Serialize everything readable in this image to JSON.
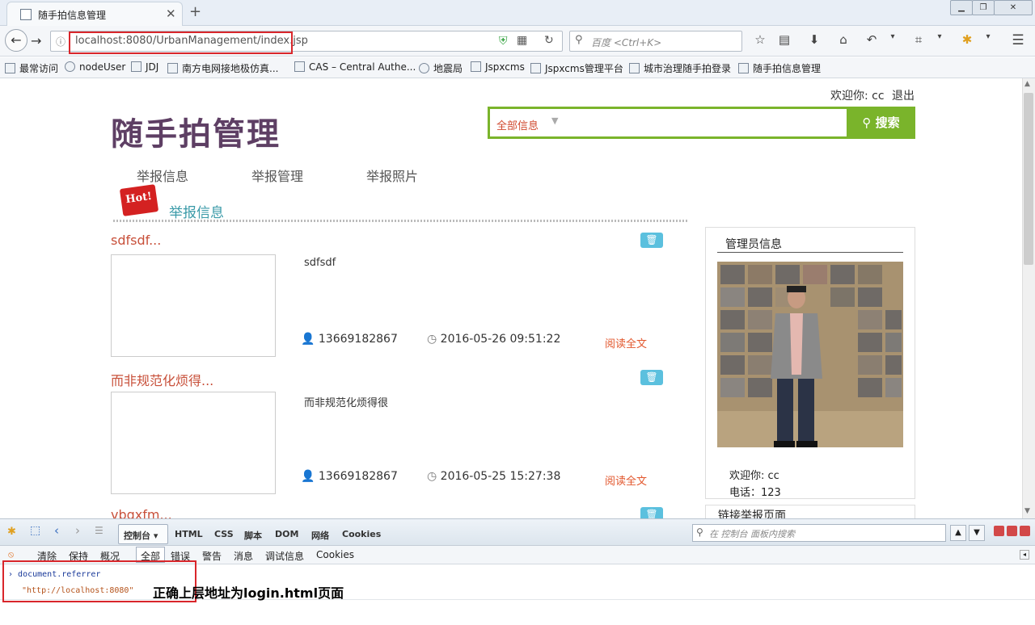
{
  "browser": {
    "tab_title": "随手拍信息管理",
    "url": "localhost:8080/UrbanManagement/index.jsp",
    "search_placeholder": "百度 <Ctrl+K>",
    "bookmarks": [
      "最常访问",
      "nodeUser",
      "JDJ",
      "南方电网接地极仿真...",
      "CAS – Central Authe...",
      "地震局",
      "Jspxcms",
      "Jspxcms管理平台",
      "城市治理随手拍登录",
      "随手拍信息管理"
    ]
  },
  "header": {
    "welcome": "欢迎你: cc",
    "logout": "退出",
    "logo_text": "随手拍管理",
    "search_category": "全部信息",
    "search_button": "搜索"
  },
  "menu": [
    "举报信息",
    "举报管理",
    "举报照片"
  ],
  "section": {
    "hot_badge": "Hot!",
    "title": "举报信息"
  },
  "items": [
    {
      "title": "sdfsdf...",
      "desc": "sdfsdf",
      "phone": "13669182867",
      "time": "2016-05-26 09:51:22",
      "read_more": "阅读全文"
    },
    {
      "title": "而非规范化烦得...",
      "desc": "而非规范化烦得很",
      "phone": "13669182867",
      "time": "2016-05-25 15:27:38",
      "read_more": "阅读全文"
    },
    {
      "title": "vbgxfm..."
    }
  ],
  "admin": {
    "title": "管理员信息",
    "welcome": "欢迎你: cc",
    "phone": "电话：123"
  },
  "link_box": {
    "title": "链接举报页面"
  },
  "devtools": {
    "tabs": [
      "控制台",
      "HTML",
      "CSS",
      "脚本",
      "DOM",
      "网络",
      "Cookies"
    ],
    "search_placeholder": "在 控制台 面板内搜索",
    "filters": [
      "清除",
      "保持",
      "概况",
      "全部",
      "错误",
      "警告",
      "消息",
      "调试信息",
      "Cookies"
    ],
    "command": "document.referrer",
    "result": "\"http://localhost:8080\"",
    "annotation": "正确上层地址为login.html页面"
  },
  "colors": {
    "accent_green": "#7ab42b",
    "logo_purple": "#5e3f64",
    "highlight_red": "#d9262b",
    "title_red": "#c8503a"
  }
}
